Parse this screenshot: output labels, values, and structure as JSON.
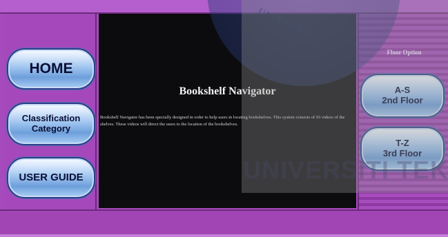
{
  "nav": {
    "home_label": "HOME",
    "classification_line1": "Classification",
    "classification_line2": "Category",
    "user_guide_label": "USER GUIDE"
  },
  "floors": {
    "header": "Floor Option",
    "as_line1": "A-S",
    "as_line2": "2nd Floor",
    "tz_line1": "T-Z",
    "tz_line2": "3rd Floor"
  },
  "main": {
    "title": "Bookshelf Navigator",
    "description": "Bookshelf Navigator has been specially designed in order to help users in locating bookshelves. This system consists of 93 videos of the shelves. These videos will direct the users to the location of the bookshelves."
  },
  "watermark": {
    "arc_text": "UNIVERSITI",
    "bottom_text": "UNIVERSITI TEK"
  },
  "colors": {
    "frame_purple": "#a64bbd",
    "panel_dark": "#0c0c0e",
    "button_blue": "#9cc2ef",
    "button_border": "#2c3e88"
  }
}
